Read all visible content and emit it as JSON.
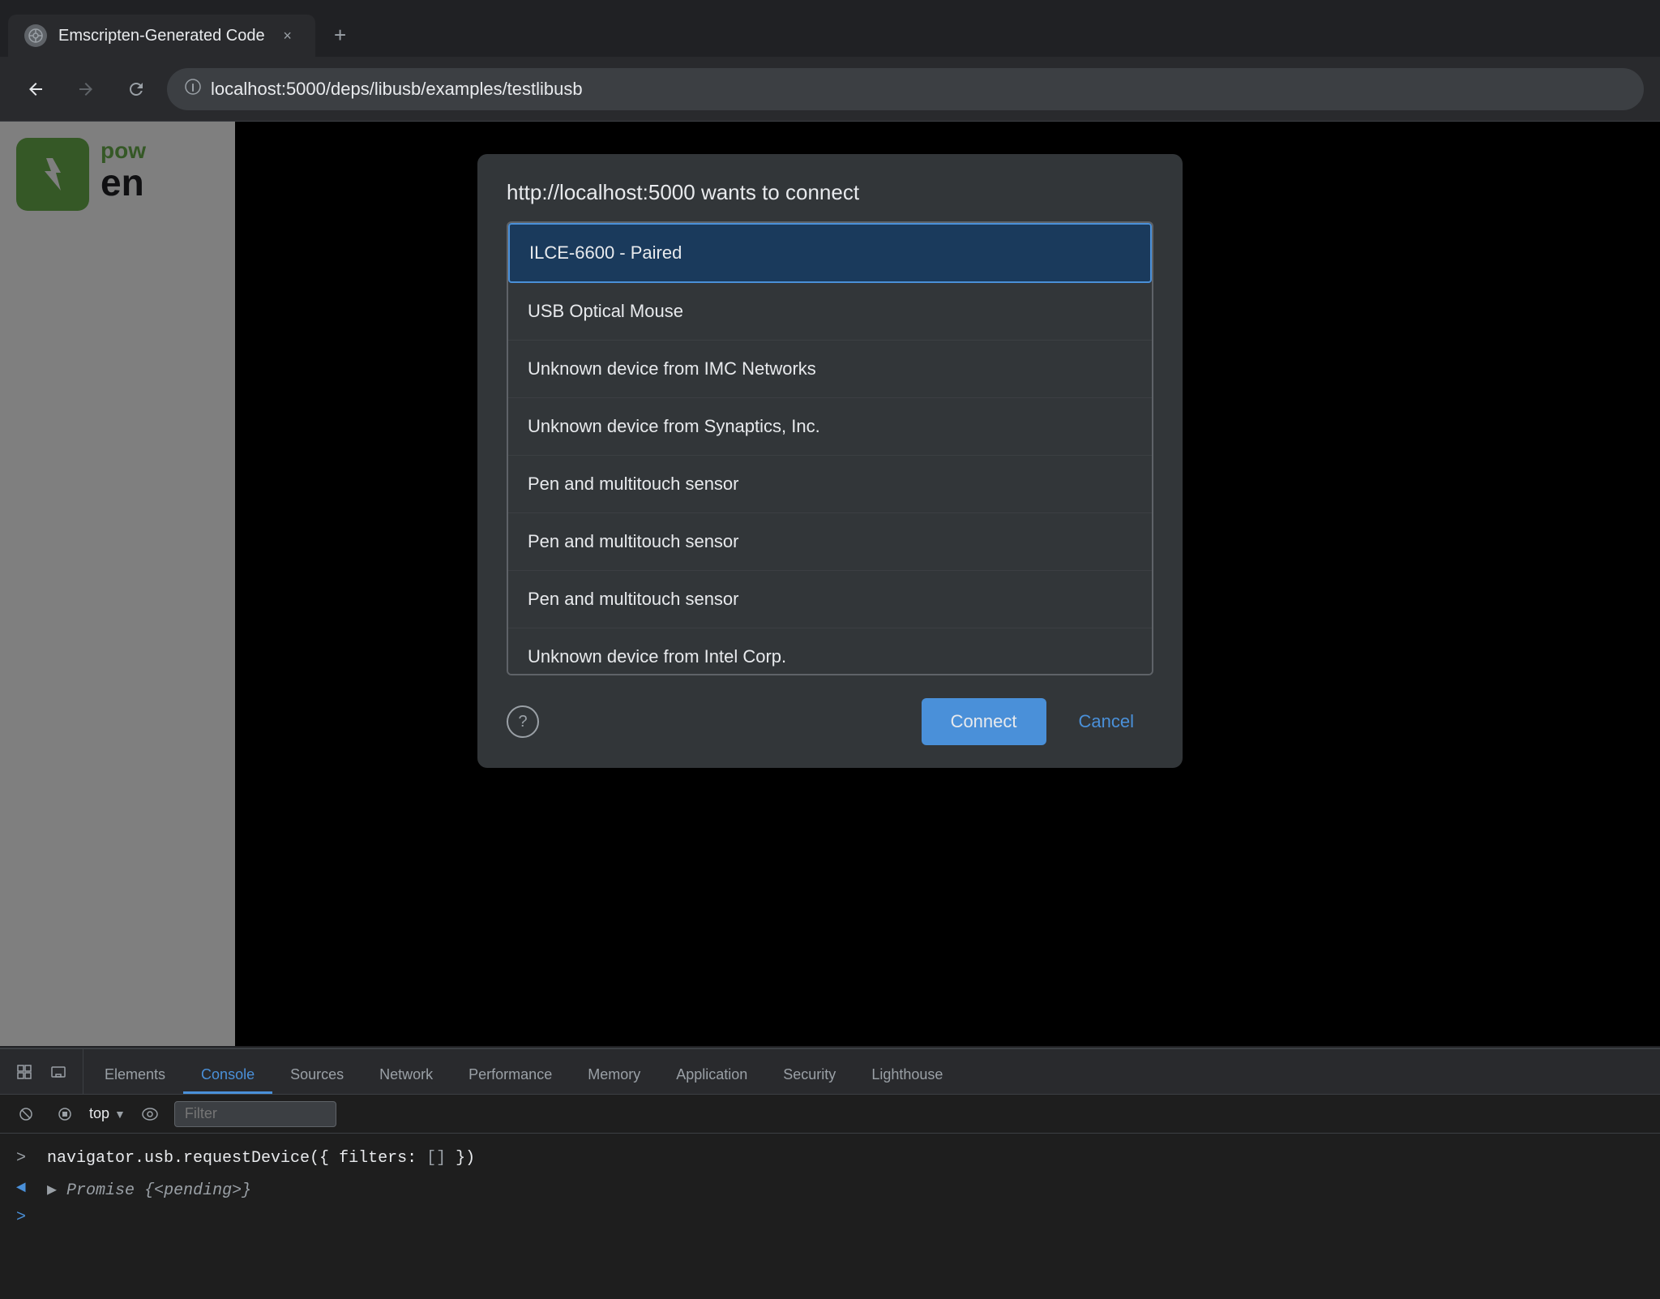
{
  "browser": {
    "tab": {
      "favicon": "⊙",
      "title": "Emscripten-Generated Code",
      "close": "×"
    },
    "new_tab": "+",
    "nav": {
      "back": "←",
      "forward": "→",
      "reload": "↺",
      "url": "localhost:5000/deps/libusb/examples/testlibusb"
    }
  },
  "dialog": {
    "title": "http://localhost:5000 wants to connect",
    "devices": [
      {
        "label": "ILCE-6600 - Paired",
        "selected": true
      },
      {
        "label": "USB Optical Mouse",
        "selected": false
      },
      {
        "label": "Unknown device from IMC Networks",
        "selected": false
      },
      {
        "label": "Unknown device from Synaptics, Inc.",
        "selected": false
      },
      {
        "label": "Pen and multitouch sensor",
        "selected": false
      },
      {
        "label": "Pen and multitouch sensor",
        "selected": false
      },
      {
        "label": "Pen and multitouch sensor",
        "selected": false
      },
      {
        "label": "Unknown device from Intel Corp.",
        "selected": false
      }
    ],
    "connect_btn": "Connect",
    "cancel_btn": "Cancel",
    "help_icon": "?"
  },
  "logo": {
    "pow": "pow",
    "en": "en"
  },
  "devtools": {
    "tabs": [
      {
        "label": "Elements",
        "active": false
      },
      {
        "label": "Console",
        "active": true
      },
      {
        "label": "Sources",
        "active": false
      },
      {
        "label": "Network",
        "active": false
      },
      {
        "label": "Performance",
        "active": false
      },
      {
        "label": "Memory",
        "active": false
      },
      {
        "label": "Application",
        "active": false
      },
      {
        "label": "Security",
        "active": false
      },
      {
        "label": "Lighthouse",
        "active": false
      }
    ],
    "toolbar": {
      "top_selector": "top",
      "filter_placeholder": "Filter"
    },
    "console": {
      "input_line": "navigator.usb.requestDevice({ filters: [] })",
      "result_label": "◄",
      "result": "Promise {<pending>}",
      "cursor": ">"
    }
  }
}
